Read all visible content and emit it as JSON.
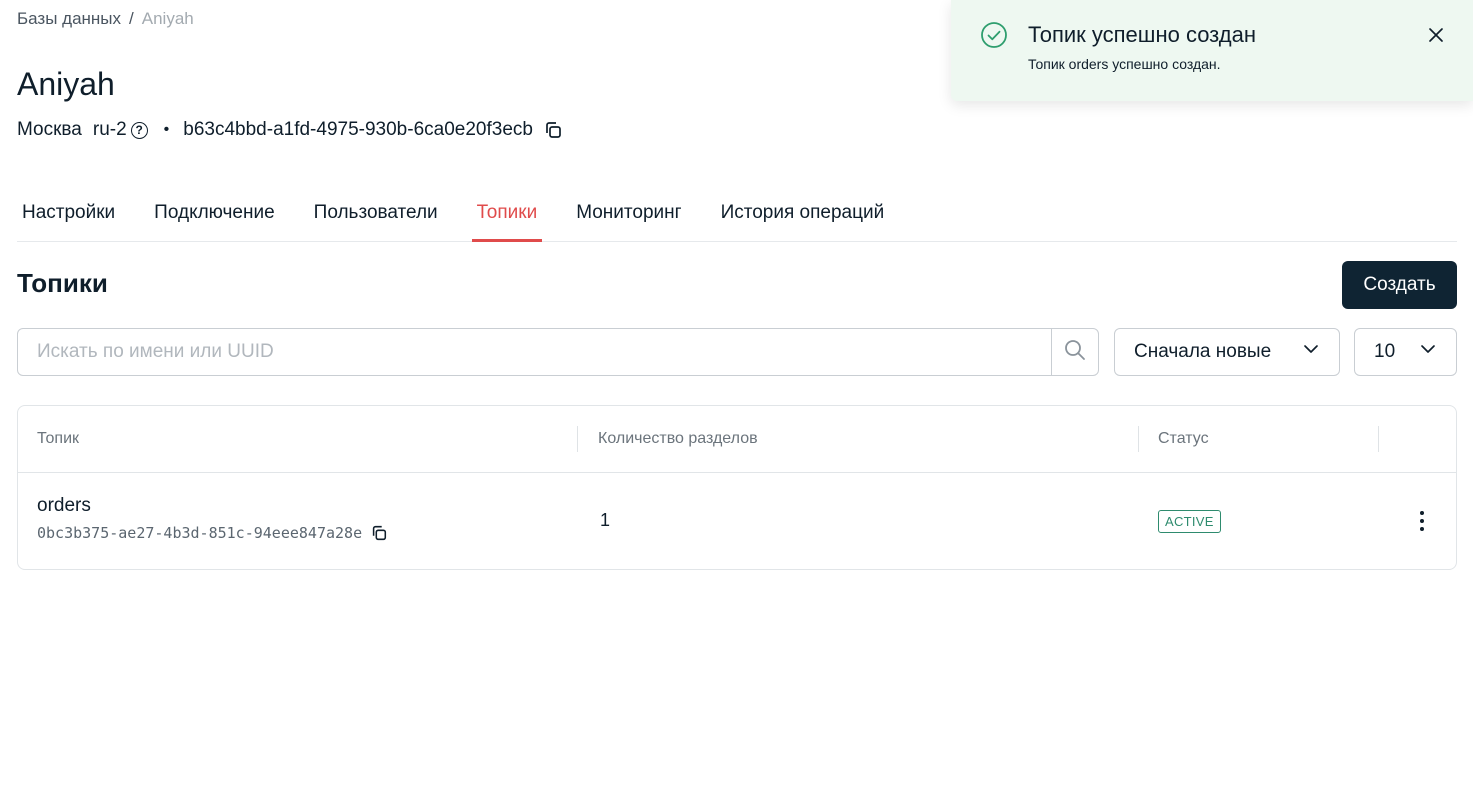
{
  "breadcrumb": {
    "root": "Базы данных",
    "separator": "/",
    "current": "Aniyah"
  },
  "page": {
    "title": "Aniyah",
    "city": "Москва",
    "region": "ru-2",
    "help_glyph": "?",
    "dot": "•",
    "uuid": "b63c4bbd-a1fd-4975-930b-6ca0e20f3ecb"
  },
  "tabs": [
    {
      "label": "Настройки",
      "active": false
    },
    {
      "label": "Подключение",
      "active": false
    },
    {
      "label": "Пользователи",
      "active": false
    },
    {
      "label": "Топики",
      "active": true
    },
    {
      "label": "Мониторинг",
      "active": false
    },
    {
      "label": "История операций",
      "active": false
    }
  ],
  "section": {
    "title": "Топики",
    "create_label": "Создать"
  },
  "search": {
    "placeholder": "Искать по имени или UUID",
    "value": ""
  },
  "sort": {
    "selected": "Сначала новые"
  },
  "page_size": {
    "selected": "10"
  },
  "table": {
    "headers": {
      "topic": "Топик",
      "partitions": "Количество разделов",
      "status": "Статус"
    },
    "rows": [
      {
        "name": "orders",
        "uuid": "0bc3b375-ae27-4b3d-851c-94eee847a28e",
        "partitions": "1",
        "status": "ACTIVE"
      }
    ]
  },
  "toast": {
    "title": "Топик успешно создан",
    "message": "Топик orders успешно создан."
  },
  "colors": {
    "accent": "#e04b4b",
    "primary_button": "#0f2433",
    "success": "#2e8b6e",
    "toast_bg": "#eef8f1"
  },
  "icons": [
    "help-icon",
    "copy-icon",
    "search-icon",
    "chevron-down-icon",
    "kebab-menu-icon",
    "check-circle-icon",
    "close-icon"
  ]
}
